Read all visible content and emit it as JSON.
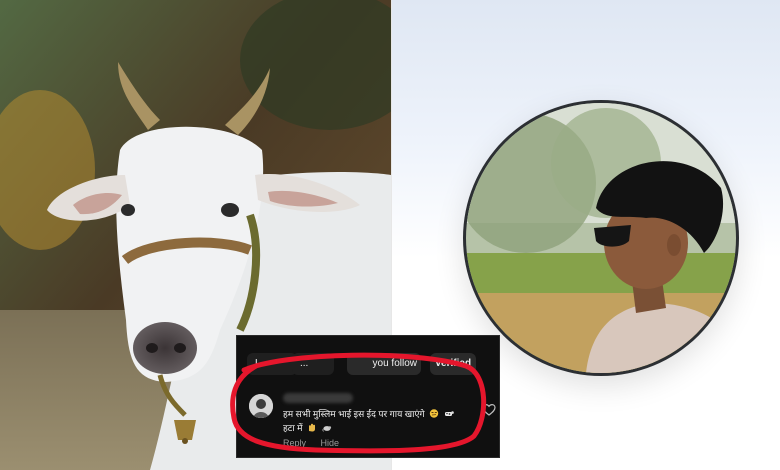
{
  "comment_card": {
    "chips": {
      "first": "L",
      "second": "...",
      "follow": "you follow",
      "verified": "Verified"
    },
    "comment_line_1": "हम सभी मुस्लिम भाई इस ईद पर गाय खाएंगे",
    "comment_line_2": "हटा में",
    "reply_label": "Reply",
    "hide_label": "Hide",
    "like_icon": "heart-outline-icon"
  },
  "colors": {
    "annotation": "#e5162c",
    "card_bg": "#101010"
  }
}
